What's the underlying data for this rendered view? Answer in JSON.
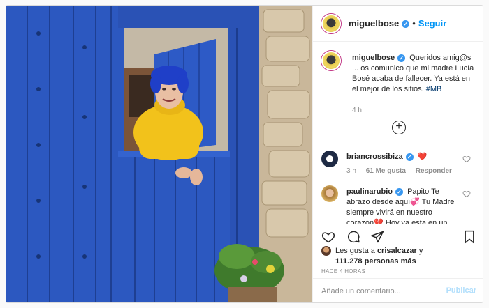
{
  "post": {
    "author": {
      "username": "miguelbose",
      "verified_icon": "verified-badge-icon",
      "follow_label": "Seguir",
      "separator": "•"
    },
    "caption": {
      "username": "miguelbose",
      "text": "Queridos amig@s ... os comunico que mi madre Lucía Bosé acaba de fallecer. Ya está en el mejor de los sitios.",
      "hashtag": "#MB",
      "time": "4 h"
    },
    "load_more_icon": "plus-circle-icon",
    "comments": [
      {
        "username": "briancrossibiza",
        "text": "❤️",
        "time": "3 h",
        "likes": "61 Me gusta",
        "reply_label": "Responder"
      },
      {
        "username": "paulinarubio",
        "text": "Papito Te abrazo desde aquí💞 Tu Madre siempre vivirá en nuestro corazón💔 Hoy va esta en un mejor sitio 🀱🀱"
      }
    ],
    "actions": {
      "like_icon": "heart-icon",
      "comment_icon": "comment-icon",
      "share_icon": "share-icon",
      "save_icon": "bookmark-icon"
    },
    "likes": {
      "prefix": "Les gusta a",
      "user": "crisalcazar",
      "conjunction": "y",
      "count": "111.278 personas más"
    },
    "posted_ago": "HACE 4 HORAS",
    "add_comment": {
      "placeholder": "Añade un comentario...",
      "publish_label": "Publicar"
    },
    "colors": {
      "accent": "#0095f6",
      "door_blue": "#2b56b8",
      "sweater_yellow": "#f2c21b",
      "publish_disabled": "#b2dffc"
    }
  }
}
